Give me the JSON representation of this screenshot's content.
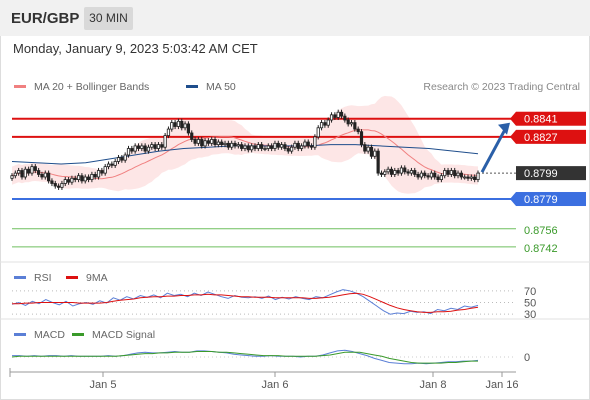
{
  "header": {
    "symbol": "EUR/GBP",
    "timeframe": "30 MIN"
  },
  "timestamp": "Monday, January 9, 2023 5:03:42 AM CET",
  "colors": {
    "resistance": "#dd1111",
    "support": "#3b6fe0",
    "target": "#3a9a2a",
    "price_label": "#333333",
    "candle": "#222222",
    "ma20": "#f08080",
    "ma50": "#1f4e8c",
    "bollinger_fill": "#fde3e3",
    "rsi": "#5b7fd6",
    "rsi_ma": "#dd1111",
    "macd": "#5b7fd6",
    "macd_signal": "#3a9a2a",
    "arrow": "#2a5fa8"
  },
  "chart_data": [
    {
      "type": "candlestick",
      "name": "price",
      "legend": [
        {
          "label": "MA 20 + Bollinger Bands",
          "color": "#f08080"
        },
        {
          "label": "MA 50",
          "color": "#1f4e8c"
        }
      ],
      "credit": "Research © 2023 Trading Central",
      "x_ticks": [
        "Jan 5",
        "Jan 6",
        "Jan 8",
        "Jan 16"
      ],
      "ylim": [
        0.8735,
        0.8857
      ],
      "close": [
        0.8797,
        0.8799,
        0.8801,
        0.8796,
        0.8802,
        0.8799,
        0.8804,
        0.8801,
        0.8798,
        0.8796,
        0.8799,
        0.8793,
        0.8791,
        0.8789,
        0.8788,
        0.8791,
        0.8794,
        0.8792,
        0.8795,
        0.8794,
        0.8797,
        0.8793,
        0.8796,
        0.8794,
        0.8798,
        0.8796,
        0.8801,
        0.8799,
        0.8804,
        0.8806,
        0.8805,
        0.8808,
        0.8811,
        0.8809,
        0.8813,
        0.8818,
        0.8816,
        0.882,
        0.8818,
        0.882,
        0.8816,
        0.8819,
        0.8821,
        0.8818,
        0.8821,
        0.8819,
        0.8828,
        0.8833,
        0.8838,
        0.8835,
        0.8839,
        0.8834,
        0.8837,
        0.883,
        0.8825,
        0.8822,
        0.8825,
        0.882,
        0.8824,
        0.8822,
        0.8825,
        0.8821,
        0.8823,
        0.8821,
        0.8822,
        0.8819,
        0.8822,
        0.882,
        0.8821,
        0.8818,
        0.882,
        0.8817,
        0.882,
        0.8818,
        0.8821,
        0.8818,
        0.8818,
        0.882,
        0.8818,
        0.8822,
        0.8819,
        0.8821,
        0.8818,
        0.8816,
        0.8819,
        0.8822,
        0.8818,
        0.882,
        0.8823,
        0.882,
        0.8819,
        0.8827,
        0.8834,
        0.8838,
        0.8836,
        0.884,
        0.8844,
        0.8842,
        0.8846,
        0.8843,
        0.884,
        0.8837,
        0.8838,
        0.8833,
        0.8831,
        0.8821,
        0.8816,
        0.8819,
        0.8812,
        0.8816,
        0.8799,
        0.8798,
        0.88,
        0.8802,
        0.8798,
        0.8801,
        0.8799,
        0.8803,
        0.88,
        0.8799,
        0.8801,
        0.8798,
        0.8796,
        0.8799,
        0.8797,
        0.8796,
        0.8799,
        0.8796,
        0.8794,
        0.8797,
        0.8801,
        0.8798,
        0.8801,
        0.8797,
        0.8799,
        0.8796,
        0.8796,
        0.8795,
        0.8796,
        0.8794,
        0.8799
      ],
      "ma50_shown_values": [
        0.8808,
        0.8807,
        0.8806,
        0.8807,
        0.881,
        0.8813,
        0.8816,
        0.8818,
        0.8819,
        0.882,
        0.882,
        0.882,
        0.882,
        0.8821,
        0.8821,
        0.882,
        0.8819,
        0.8818,
        0.8816,
        0.8814
      ],
      "levels": [
        {
          "value": "0.8841",
          "kind": "resistance"
        },
        {
          "value": "0.8827",
          "kind": "resistance"
        },
        {
          "value": "0.8799",
          "kind": "last"
        },
        {
          "value": "0.8779",
          "kind": "support"
        },
        {
          "value": "0.8756",
          "kind": "target"
        },
        {
          "value": "0.8742",
          "kind": "target"
        }
      ]
    },
    {
      "type": "line",
      "name": "RSI panel",
      "legend": [
        {
          "label": "RSI",
          "color": "#5b7fd6"
        },
        {
          "label": "9MA",
          "color": "#dd1111"
        }
      ],
      "y_ticks": [
        "70",
        "50",
        "30"
      ],
      "ylim": [
        20,
        80
      ],
      "series": [
        {
          "name": "RSI",
          "values": [
            47,
            50,
            45,
            52,
            48,
            55,
            50,
            46,
            52,
            44,
            48,
            50,
            47,
            53,
            49,
            58,
            54,
            60,
            56,
            62,
            59,
            63,
            58,
            66,
            62,
            64,
            60,
            66,
            62,
            68,
            64,
            60,
            57,
            62,
            59,
            58,
            60,
            57,
            61,
            55,
            59,
            56,
            60,
            57,
            55,
            60,
            58,
            63,
            68,
            72,
            70,
            66,
            60,
            52,
            44,
            36,
            30,
            32,
            31,
            35,
            33,
            34,
            31,
            38,
            36,
            40,
            38,
            44,
            42,
            45
          ]
        },
        {
          "name": "9MA",
          "values": [
            48,
            48,
            49,
            49,
            50,
            50,
            50,
            50,
            50,
            50,
            49,
            49,
            49,
            49,
            50,
            52,
            54,
            55,
            56,
            58,
            59,
            60,
            60,
            61,
            61,
            62,
            62,
            63,
            63,
            64,
            63,
            63,
            62,
            61,
            60,
            60,
            59,
            59,
            59,
            58,
            58,
            58,
            58,
            58,
            57,
            57,
            58,
            59,
            61,
            63,
            65,
            66,
            64,
            60,
            55,
            50,
            45,
            41,
            38,
            36,
            34,
            33,
            33,
            34,
            34,
            35,
            37,
            38,
            40,
            42
          ]
        }
      ]
    },
    {
      "type": "line",
      "name": "MACD panel",
      "legend": [
        {
          "label": "MACD",
          "color": "#5b7fd6"
        },
        {
          "label": "MACD Signal",
          "color": "#3a9a2a"
        }
      ],
      "y_ticks": [
        "0"
      ],
      "ylim": [
        -0.0022,
        0.0022
      ],
      "series": [
        {
          "name": "MACD",
          "values": [
            0.0002,
            0.0002,
            0.0001,
            0.0002,
            0.0001,
            0.0002,
            0.0002,
            0.0001,
            0.0002,
            0.0001,
            0.0001,
            0.0001,
            0.0001,
            0.0002,
            0.0001,
            0.0002,
            0.0004,
            0.0006,
            0.0007,
            0.0006,
            0.0006,
            0.0007,
            0.0008,
            0.0007,
            0.0007,
            0.0009,
            0.0009,
            0.0008,
            0.0007,
            0.0006,
            0.0004,
            0.0003,
            0.0002,
            0.0001,
            0.0001,
            0.0002,
            0.0001,
            0.0001,
            0.0001,
            0.0,
            0.0001,
            0.0001,
            0.0003,
            0.0006,
            0.0009,
            0.001,
            0.0008,
            0.0005,
            0.0002,
            -0.0002,
            -0.0005,
            -0.0008,
            -0.0009,
            -0.001,
            -0.001,
            -0.0009,
            -0.001,
            -0.0009,
            -0.0008,
            -0.0007,
            -0.0007,
            -0.0006,
            -0.0006,
            -0.0005
          ]
        },
        {
          "name": "MACD Signal",
          "values": [
            0.0,
            0.0001,
            0.0001,
            0.0001,
            0.0001,
            0.0001,
            0.0001,
            0.0001,
            0.0001,
            0.0001,
            0.0001,
            0.0001,
            0.0001,
            0.0001,
            0.0001,
            0.0002,
            0.0003,
            0.0004,
            0.0005,
            0.0005,
            0.0006,
            0.0006,
            0.0007,
            0.0007,
            0.0007,
            0.0008,
            0.0008,
            0.0008,
            0.0007,
            0.0007,
            0.0006,
            0.0005,
            0.0004,
            0.0003,
            0.0002,
            0.0002,
            0.0002,
            0.0001,
            0.0001,
            0.0001,
            0.0001,
            0.0001,
            0.0002,
            0.0003,
            0.0005,
            0.0007,
            0.0007,
            0.0007,
            0.0005,
            0.0003,
            0.0001,
            -0.0002,
            -0.0004,
            -0.0006,
            -0.0008,
            -0.0009,
            -0.0009,
            -0.0009,
            -0.0009,
            -0.0008,
            -0.0008,
            -0.0007,
            -0.0006,
            -0.0006
          ]
        }
      ]
    }
  ]
}
